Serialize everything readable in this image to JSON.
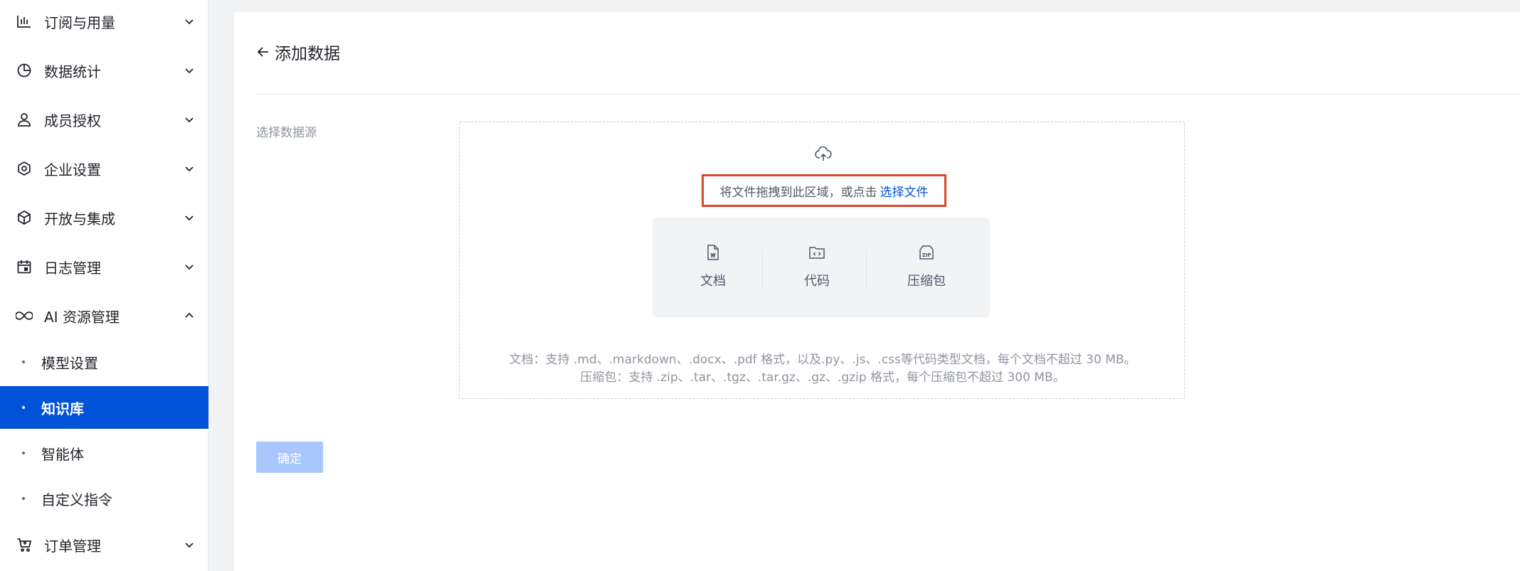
{
  "sidebar": {
    "menu": [
      {
        "label": "订阅与用量",
        "icon": "bar-chart-icon",
        "expanded": false
      },
      {
        "label": "数据统计",
        "icon": "pie-chart-icon",
        "expanded": false
      },
      {
        "label": "成员授权",
        "icon": "user-icon",
        "expanded": false
      },
      {
        "label": "企业设置",
        "icon": "settings-icon",
        "expanded": false
      },
      {
        "label": "开放与集成",
        "icon": "cube-icon",
        "expanded": false
      },
      {
        "label": "日志管理",
        "icon": "calendar-icon",
        "expanded": false
      },
      {
        "label": "AI 资源管理",
        "icon": "infinity-icon",
        "expanded": true
      }
    ],
    "sub_items": [
      {
        "label": "模型设置",
        "active": false
      },
      {
        "label": "知识库",
        "active": true
      },
      {
        "label": "智能体",
        "active": false
      },
      {
        "label": "自定义指令",
        "active": false
      }
    ],
    "bottom_menu": {
      "label": "订单管理",
      "icon": "cart-icon",
      "expanded": false
    }
  },
  "main": {
    "title": "添加数据",
    "field_label": "选择数据源",
    "upload": {
      "hint": "将文件拖拽到此区域，或点击",
      "link": "选择文件"
    },
    "types": [
      {
        "label": "文档",
        "icon": "document-icon"
      },
      {
        "label": "代码",
        "icon": "code-folder-icon"
      },
      {
        "label": "压缩包",
        "icon": "zip-icon"
      }
    ],
    "desc_line1": "文档：支持 .md、.markdown、.docx、.pdf 格式，以及.py、.js、.css等代码类型文档，每个文档不超过 30 MB。",
    "desc_line2": "压缩包：支持 .zip、.tar、.tgz、.tar.gz、.gz、.gzip 格式，每个压缩包不超过 300 MB。",
    "confirm_label": "确定"
  },
  "colors": {
    "accent": "#0052d9",
    "highlight_border": "#d9472b",
    "disabled_button": "#a9c7ff"
  }
}
